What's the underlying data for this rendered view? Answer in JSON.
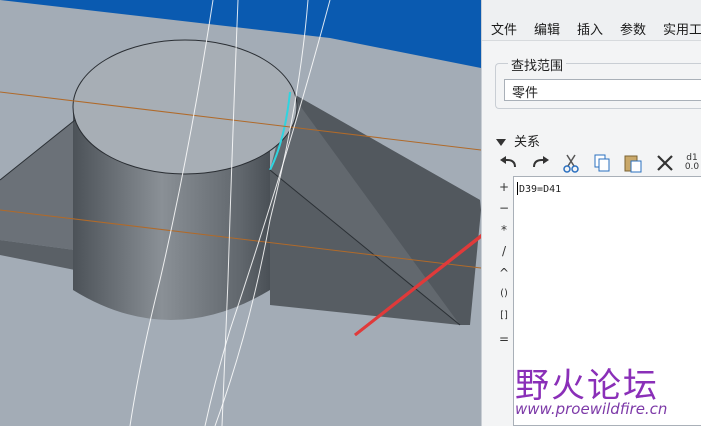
{
  "menu": {
    "items": [
      "文件",
      "编辑",
      "插入",
      "参数",
      "实用工"
    ]
  },
  "find_scope": {
    "title": "查找范围",
    "value": "零件"
  },
  "relations": {
    "header": "关系",
    "toolbar_icons": [
      "undo-icon",
      "redo-icon",
      "cut-icon",
      "copy-icon",
      "paste-icon",
      "delete-icon",
      "units-icon"
    ],
    "units_label_top": "d1",
    "units_label_bottom": "0.0",
    "operators": [
      "+",
      "−",
      "*",
      "/",
      "^",
      "()",
      "[]",
      "="
    ],
    "code": "D39=D41"
  },
  "watermark": {
    "cn": "野火论坛",
    "url": "www.proewildfire.cn"
  },
  "colors": {
    "viewport_bg": "#a3acb6",
    "viewport_top_band": "#0a5ab0",
    "highlight_edge": "#30d4e0",
    "arrow": "#e03a3a",
    "datum_plane": "#b06a2a"
  }
}
